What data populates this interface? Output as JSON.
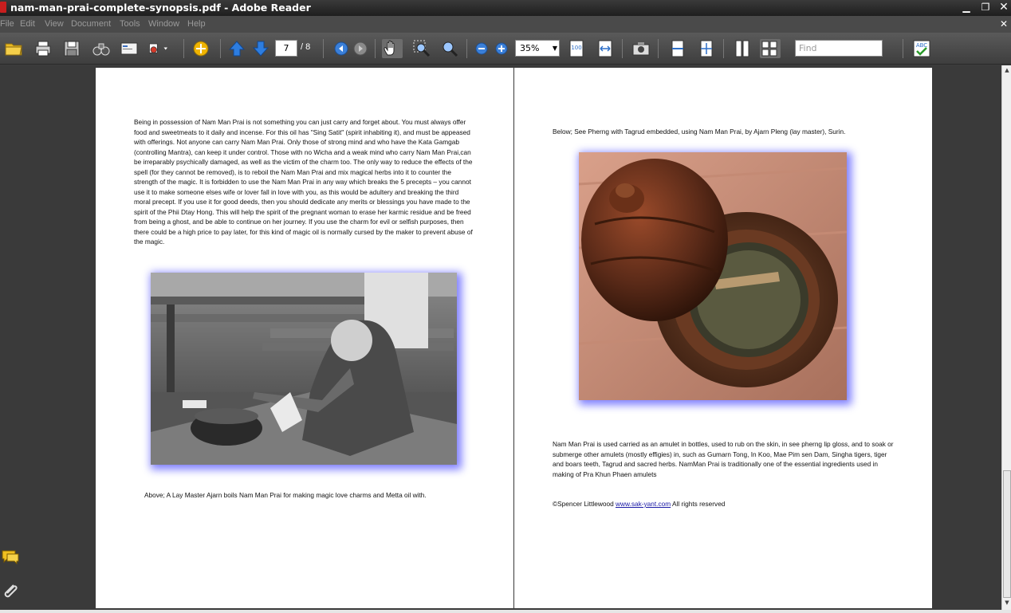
{
  "window": {
    "title": "nam-man-prai-complete-synopsis.pdf - Adobe Reader",
    "min_label": "▁",
    "max_label": "❐",
    "close_label": "✕"
  },
  "menu": {
    "items": [
      "File",
      "Edit",
      "View",
      "Document",
      "Tools",
      "Window",
      "Help"
    ],
    "doc_close": "✕"
  },
  "toolbar": {
    "page_current": "7",
    "page_total": "/ 8",
    "zoom": "35%",
    "find_placeholder": "Find"
  },
  "left_page": {
    "paragraph": "Being in possession of Nam Man Prai is not something you can just carry and forget about. You must always offer food and sweetmeats to it daily and incense. For this oil has \"Sing Satit\" (spirit inhabiting it), and must be appeased with offerings. Not anyone can carry Nam Man Prai. Only those of strong mind and who have the Kata Gamgab (controlling Mantra), can keep it under control. Those with no Wicha and a weak mind  who carry Nam Man Prai,can be irreparably  psychically damaged, as well as the victim of the charm too. The only way to reduce the effects of the spell (for they cannot be removed), is to reboil the Nam Man Prai and mix magical herbs into it to counter the strength of the magic. It is forbidden to use the Nam Man Prai in any way which breaks the 5 precepts – you cannot use it to make someone elses wife or lover fall in love with you, as this would be adultery and breaking the third moral precept. If you use it for good deeds, then you should dedicate any merits or blessings you have made to the spirit of the Phii Dtay Hong. This will help the spirit of the pregnant woman to erase her karmic residue and be freed from being a ghost, and be able to continue on her journey. If you use the charm for evil or selfish purposes, then there could be a high price to pay later, for this kind of magic  oil is normally cursed by the maker to prevent abuse of the magic.",
    "caption": "Above; A Lay Master Ajarn boils Nam Man Prai for making magic love charms and Metta oil with."
  },
  "right_page": {
    "caption_top": "Below; See Pherng with Tagrud embedded, using Nam Man Prai, by Ajarn Pleng (lay master), Surin.",
    "paragraph": "Nam Man Prai is used  carried as an amulet in bottles, used to rub on the skin, in see pherng lip gloss, and to soak or submerge other amulets (mostly effigies) in, such as Gumarn Tong, In Koo, Mae Pim sen Dam, Singha tigers, tiger and boars teeth, Tagrud and sacred herbs. NamMan Prai is traditionally one of the essential ingredients used in making of Pra Khun Phaen amulets",
    "copyright_prefix": "©Spencer Littlewood ",
    "copyright_link": "www.sak-yant.com",
    "copyright_suffix": " All rights reserved"
  },
  "colors": {
    "titlebar": "#1e1e1e",
    "toolbar": "#4a4a4a",
    "photo_shadow": "#8080ff",
    "link": "#1a1aa6"
  }
}
